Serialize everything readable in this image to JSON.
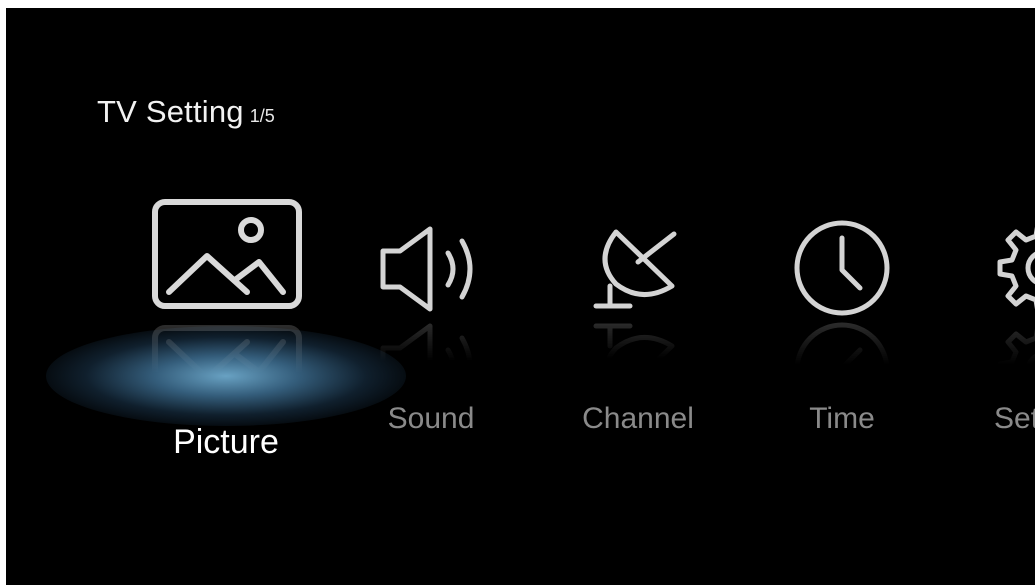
{
  "header": {
    "title": "TV Setting",
    "page_indicator": "1/5"
  },
  "menu": {
    "selected_index": 0,
    "items": [
      {
        "label": "Picture",
        "icon": "picture-icon"
      },
      {
        "label": "Sound",
        "icon": "speaker-icon"
      },
      {
        "label": "Channel",
        "icon": "satellite-dish-icon"
      },
      {
        "label": "Time",
        "icon": "clock-icon"
      },
      {
        "label": "Setup",
        "icon": "gear-icon"
      }
    ]
  },
  "colors": {
    "background": "#000000",
    "selected_label": "#ffffff",
    "unselected_label": "#8a8a8a",
    "highlight_glow": "#6eaacd"
  }
}
